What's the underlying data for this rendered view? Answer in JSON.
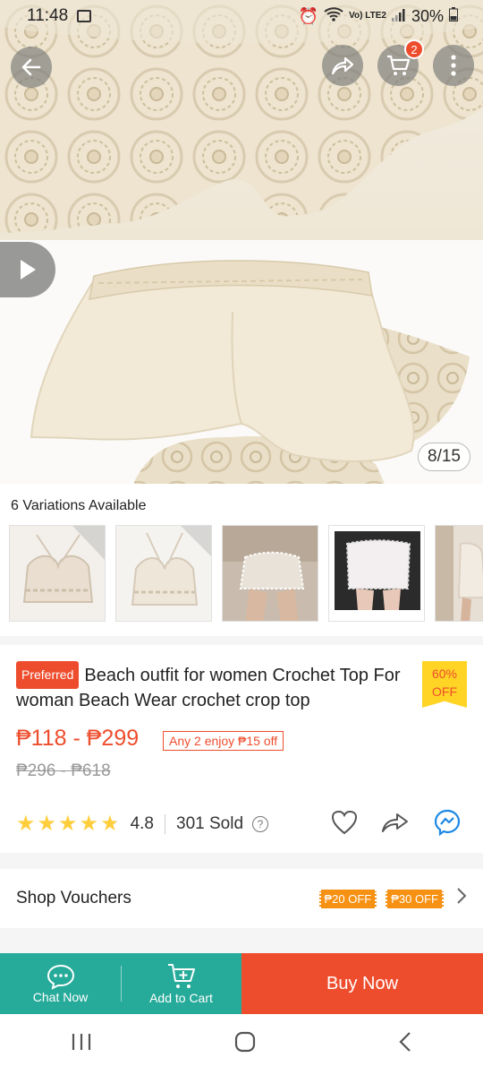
{
  "status_bar": {
    "time": "11:48",
    "network": "Vo) LTE2",
    "battery": "30%"
  },
  "gallery": {
    "counter": "8/15",
    "cart_count": "2"
  },
  "variations": {
    "title": "6 Variations Available"
  },
  "product": {
    "badge": "Preferred",
    "title": "Beach outfit for women Crochet Top For woman Beach Wear crochet crop top",
    "discount_tag": "60%",
    "discount_tag_word": "OFF",
    "price": "₱118 - ₱299",
    "promo": "Any 2 enjoy ₱15 off",
    "original_price": "₱296 - ₱618",
    "rating": "4.8",
    "rating_stars": 4.8,
    "sold": "301 Sold"
  },
  "vouchers": {
    "label": "Shop Vouchers",
    "tag1": "₱20 OFF",
    "tag2": "₱30 OFF"
  },
  "bottom_bar": {
    "chat": "Chat Now",
    "add_to_cart": "Add to Cart",
    "buy_now": "Buy Now"
  },
  "colors": {
    "accent": "#ee4d2d",
    "teal": "#26aa99",
    "star": "#ffce3d",
    "voucher": "#f69113"
  }
}
